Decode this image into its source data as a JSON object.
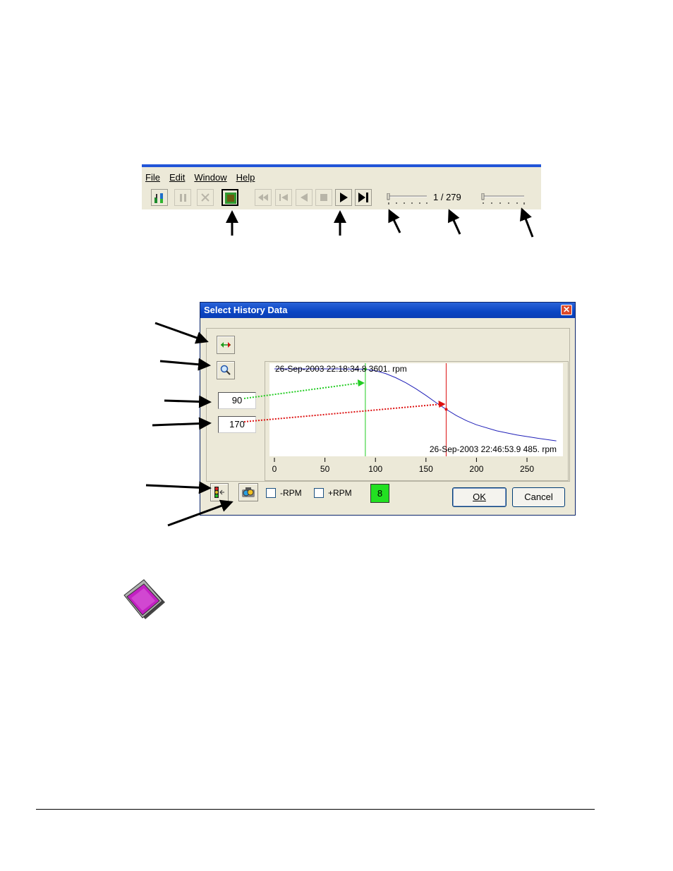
{
  "menu": {
    "file": "File",
    "edit": "Edit",
    "window": "Window",
    "help": "Help"
  },
  "toolbar": {
    "icons": [
      "plot-icon",
      "pause-icon",
      "stop-icon",
      "history-icon",
      "rewind-icon",
      "skip-start-icon",
      "step-back-icon",
      "stop-square-icon",
      "play-icon",
      "skip-end-icon"
    ],
    "counter": "1 / 279"
  },
  "dialog": {
    "title": "Select History Data",
    "start_value": "90",
    "end_value": "170",
    "neg_rpm_label": "-RPM",
    "pos_rpm_label": "+RPM",
    "indicator_value": "8",
    "ok_label": "OK",
    "cancel_label": "Cancel"
  },
  "chart_data": {
    "type": "line",
    "x_ticks": [
      "0",
      "50",
      "100",
      "150",
      "200",
      "250"
    ],
    "xlim": [
      0,
      280
    ],
    "top_label": "26-Sep-2003 22:18:34.8  3601.  rpm",
    "bottom_label": "26-Sep-2003 22:46:53.9  485.  rpm",
    "start_cursor": 90,
    "end_cursor": 170,
    "series": [
      {
        "x": [
          0,
          60,
          90,
          100,
          110,
          120,
          130,
          140,
          150,
          160,
          170,
          180,
          190,
          200,
          220,
          240,
          260,
          279
        ],
        "y": [
          3601,
          3601,
          3590,
          3520,
          3400,
          3220,
          3000,
          2740,
          2450,
          2140,
          1850,
          1580,
          1360,
          1180,
          920,
          740,
          600,
          485
        ]
      }
    ],
    "colors": {
      "line": "#2020b8",
      "start_cursor": "#22cc22",
      "end_cursor": "#dd1111"
    }
  }
}
